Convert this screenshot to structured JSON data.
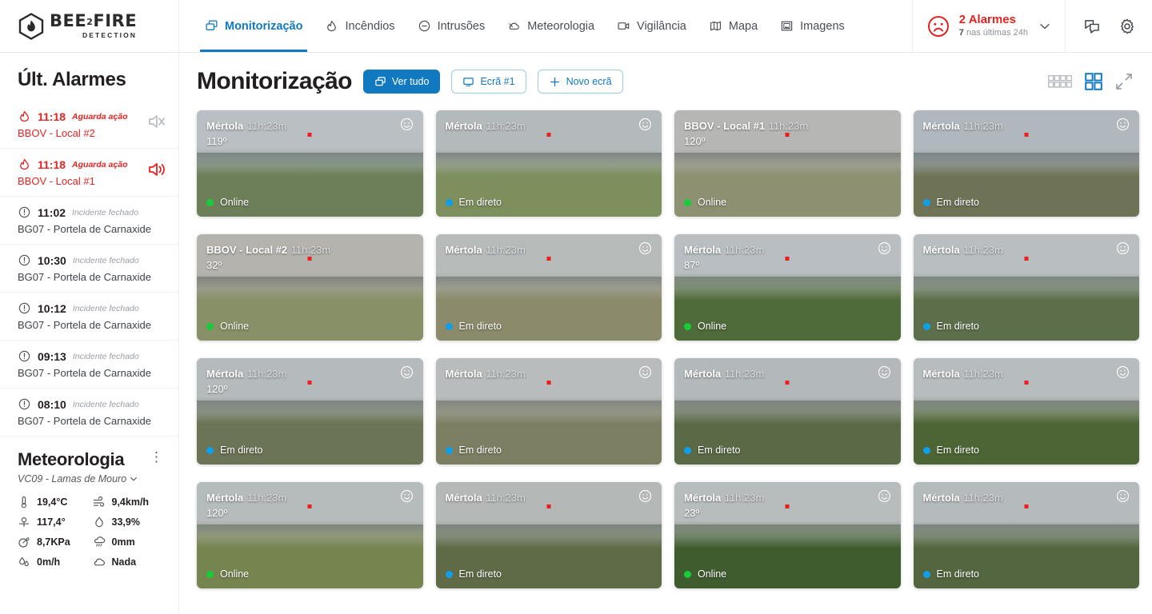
{
  "brand": {
    "name_main": "BEE",
    "name_sub_num": "2",
    "name_main2": "FIRE",
    "name_sub": "DETECTION"
  },
  "nav": {
    "items": [
      {
        "label": "Monitorização",
        "icon": "copy-screens-icon",
        "active": true
      },
      {
        "label": "Incêndios",
        "icon": "fire-icon",
        "active": false
      },
      {
        "label": "Intrusões",
        "icon": "minus-circle-icon",
        "active": false
      },
      {
        "label": "Meteorologia",
        "icon": "cloud-icon",
        "active": false
      },
      {
        "label": "Vigilância",
        "icon": "camera-icon",
        "active": false
      },
      {
        "label": "Mapa",
        "icon": "map-icon",
        "active": false
      },
      {
        "label": "Imagens",
        "icon": "images-icon",
        "active": false
      }
    ]
  },
  "alarm_indicator": {
    "count_label": "2 Alarmes",
    "sub_count": "7",
    "sub_text": "nas últimas 24h",
    "icon": "sad-face-icon",
    "color": "#e52421"
  },
  "header_tools": [
    {
      "name": "chat-icon"
    },
    {
      "name": "gear-icon"
    }
  ],
  "sidebar": {
    "title": "Últ. Alarmes",
    "alarms": [
      {
        "time": "11:18",
        "state": "Aguarda ação",
        "place": "BBOV - Local #2",
        "active": true,
        "icon": "fire-icon",
        "speaker": "speaker-muted-icon"
      },
      {
        "time": "11:18",
        "state": "Aguarda ação",
        "place": "BBOV - Local #1",
        "active": true,
        "icon": "fire-icon",
        "speaker": "speaker-on-icon"
      },
      {
        "time": "11:02",
        "state": "Incidente fechado",
        "place": "BG07 - Portela de Carnaxide",
        "active": false,
        "icon": "alert-circle-icon",
        "speaker": ""
      },
      {
        "time": "10:30",
        "state": "Incidente fechado",
        "place": "BG07 - Portela de Carnaxide",
        "active": false,
        "icon": "alert-circle-icon",
        "speaker": ""
      },
      {
        "time": "10:12",
        "state": "Incidente fechado",
        "place": "BG07 - Portela de Carnaxide",
        "active": false,
        "icon": "alert-circle-icon",
        "speaker": ""
      },
      {
        "time": "09:13",
        "state": "Incidente fechado",
        "place": "BG07 - Portela de Carnaxide",
        "active": false,
        "icon": "alert-circle-icon",
        "speaker": ""
      },
      {
        "time": "08:10",
        "state": "Incidente fechado",
        "place": "BG07 - Portela de Carnaxide",
        "active": false,
        "icon": "alert-circle-icon",
        "speaker": ""
      }
    ],
    "meteo": {
      "title": "Meteorologia",
      "menu_icon": "kebab-menu-icon",
      "station": "VC09 - Lamas de Mouro",
      "metrics": [
        {
          "icon": "thermometer-icon",
          "value": "19,4°C"
        },
        {
          "icon": "wind-icon",
          "value": "9,4km/h"
        },
        {
          "icon": "wind-direction-icon",
          "value": "117,4°"
        },
        {
          "icon": "humidity-drop-icon",
          "value": "33,9%"
        },
        {
          "icon": "pressure-icon",
          "value": "8,7KPa"
        },
        {
          "icon": "rain-icon",
          "value": "0mm"
        },
        {
          "icon": "precipitation-rate-icon",
          "value": "0m/h"
        },
        {
          "icon": "cloud-icon",
          "value": "Nada"
        }
      ]
    }
  },
  "main": {
    "page_title": "Monitorização",
    "buttons": [
      {
        "label": "Ver tudo",
        "icon": "copy-screens-icon",
        "style": "primary"
      },
      {
        "label": "Ecrã #1",
        "icon": "monitor-icon",
        "style": "outline"
      },
      {
        "label": "Novo ecrã",
        "icon": "plus-icon",
        "style": "outline"
      }
    ],
    "view_controls": [
      {
        "name": "grid-8-view-icon",
        "active": false
      },
      {
        "name": "grid-4-view-icon",
        "active": true
      },
      {
        "name": "fullscreen-expand-icon",
        "active": false
      }
    ],
    "accent_color": "#1179bf",
    "cameras": [
      {
        "name": "Mértola",
        "time": "11h:23m",
        "degrees": "119º",
        "status": "Online",
        "status_type": "online",
        "smiley": true,
        "sky": "#b9bfc2",
        "land": "#6d7f58",
        "haze": "#9aa6a4"
      },
      {
        "name": "Mértola",
        "time": "11h:23m",
        "degrees": "",
        "status": "Em direto",
        "status_type": "live",
        "smiley": true,
        "sky": "#b4b9bb",
        "land": "#7c8f5d",
        "haze": "#a3aaa6"
      },
      {
        "name": "BBOV - Local #1",
        "time": "11h:23m",
        "degrees": "120º",
        "status": "Online",
        "status_type": "online",
        "smiley": false,
        "sky": "#b6b7b4",
        "land": "#8d9071",
        "haze": "#a9a9a2"
      },
      {
        "name": "Mértola",
        "time": "11h:23m",
        "degrees": "",
        "status": "Em direto",
        "status_type": "live",
        "smiley": true,
        "sky": "#b0b8bd",
        "land": "#6e7356",
        "haze": "#9ba5a8"
      },
      {
        "name": "BBOV - Local #2",
        "time": "11h:23m",
        "degrees": "32º",
        "status": "Online",
        "status_type": "online",
        "smiley": false,
        "sky": "#b4b3ae",
        "land": "#879067",
        "haze": "#a6a59c"
      },
      {
        "name": "Mértola",
        "time": "11h:23m",
        "degrees": "",
        "status": "Em direto",
        "status_type": "live",
        "smiley": true,
        "sky": "#b7bbba",
        "land": "#8b8a6a",
        "haze": "#a8aaa4"
      },
      {
        "name": "Mértola",
        "time": "11h:23m",
        "degrees": "87º",
        "status": "Online",
        "status_type": "online",
        "smiley": true,
        "sky": "#b8bec1",
        "land": "#4f6b3a",
        "haze": "#97a391"
      },
      {
        "name": "Mértola",
        "time": "11h:23m",
        "degrees": "",
        "status": "Em direto",
        "status_type": "live",
        "smiley": true,
        "sky": "#b9bec0",
        "land": "#5d6f4a",
        "haze": "#9aa59c"
      },
      {
        "name": "Mértola",
        "time": "11h:23m",
        "degrees": "120º",
        "status": "Em direto",
        "status_type": "live",
        "smiley": true,
        "sky": "#b5babc",
        "land": "#6b7454",
        "haze": "#9ba39d"
      },
      {
        "name": "Mértola",
        "time": "11h:23m",
        "degrees": "",
        "status": "Em direto",
        "status_type": "live",
        "smiley": true,
        "sky": "#b8bcbc",
        "land": "#7d7f62",
        "haze": "#a4a69c"
      },
      {
        "name": "Mértola",
        "time": "11h:23m",
        "degrees": "",
        "status": "Em direto",
        "status_type": "live",
        "smiley": true,
        "sky": "#b3b9bb",
        "land": "#5a6a46",
        "haze": "#98a096"
      },
      {
        "name": "Mértola",
        "time": "11h:23m",
        "degrees": "",
        "status": "Em direto",
        "status_type": "live",
        "smiley": true,
        "sky": "#b7bcbe",
        "land": "#4d6434",
        "haze": "#96a08e"
      },
      {
        "name": "Mértola",
        "time": "11h:23m",
        "degrees": "120º",
        "status": "Online",
        "status_type": "online",
        "smiley": true,
        "sky": "#b6bbbb",
        "land": "#76854f",
        "haze": "#a0a694"
      },
      {
        "name": "Mértola",
        "time": "11h:23m",
        "degrees": "",
        "status": "Em direto",
        "status_type": "live",
        "smiley": true,
        "sky": "#b4b8b6",
        "land": "#5e6b46",
        "haze": "#9aa096"
      },
      {
        "name": "Mértola",
        "time": "11h:23m",
        "degrees": "23º",
        "status": "Online",
        "status_type": "online",
        "smiley": true,
        "sky": "#b7bcbd",
        "land": "#3f5c2e",
        "haze": "#92a08c"
      },
      {
        "name": "Mértola",
        "time": "11h:23m",
        "degrees": "",
        "status": "Em direto",
        "status_type": "live",
        "smiley": true,
        "sky": "#b5babd",
        "land": "#53663f",
        "haze": "#97a094"
      }
    ]
  }
}
